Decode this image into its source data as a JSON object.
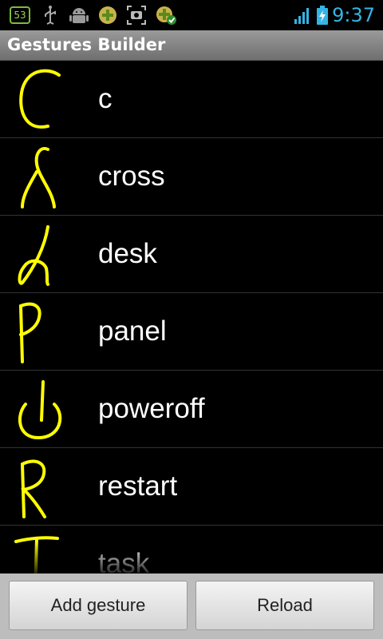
{
  "status_bar": {
    "notification_badge": "53",
    "icons": [
      "badge-53-icon",
      "usb-icon",
      "android-debug-icon",
      "app-notification-icon",
      "screenshot-icon",
      "app-update-icon",
      "signal-icon",
      "battery-charging-icon"
    ],
    "time": "9:37"
  },
  "app": {
    "title": "Gestures Builder"
  },
  "gestures": [
    {
      "label": "c",
      "icon": "gesture-c-icon"
    },
    {
      "label": "cross",
      "icon": "gesture-cross-icon"
    },
    {
      "label": "desk",
      "icon": "gesture-desk-icon"
    },
    {
      "label": "panel",
      "icon": "gesture-panel-icon"
    },
    {
      "label": "poweroff",
      "icon": "gesture-poweroff-icon"
    },
    {
      "label": "restart",
      "icon": "gesture-restart-icon"
    },
    {
      "label": "task",
      "icon": "gesture-task-icon"
    }
  ],
  "buttons": {
    "add_label": "Add gesture",
    "reload_label": "Reload"
  },
  "colors": {
    "gesture_stroke": "#ffff00",
    "accent": "#33b5e5",
    "title_bar": "#8a8a8a"
  }
}
